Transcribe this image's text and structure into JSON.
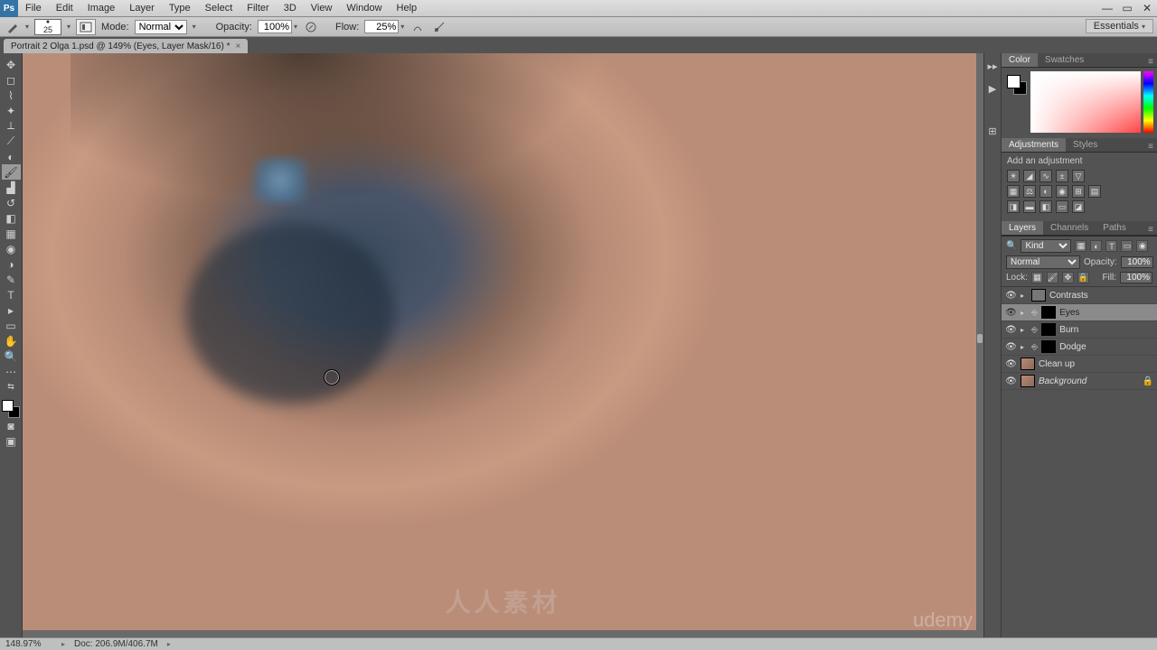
{
  "menubar": [
    "File",
    "Edit",
    "Image",
    "Layer",
    "Type",
    "Select",
    "Filter",
    "3D",
    "View",
    "Window",
    "Help"
  ],
  "options": {
    "brush_size": "25",
    "mode_label": "Mode:",
    "mode_value": "Normal",
    "opacity_label": "Opacity:",
    "opacity_value": "100%",
    "flow_label": "Flow:",
    "flow_value": "25%"
  },
  "workspace_label": "Essentials",
  "doc_tab": "Portrait 2 Olga 1.psd @ 149% (Eyes, Layer Mask/16) *",
  "panels": {
    "color_tab": "Color",
    "swatches_tab": "Swatches",
    "adjustments_tab": "Adjustments",
    "styles_tab": "Styles",
    "add_adjust": "Add an adjustment",
    "layers_tab": "Layers",
    "channels_tab": "Channels",
    "paths_tab": "Paths",
    "kind_label": "Kind",
    "blend_mode": "Normal",
    "opacity_lbl": "Opacity:",
    "opacity_val": "100%",
    "lock_lbl": "Lock:",
    "fill_lbl": "Fill:",
    "fill_val": "100%"
  },
  "layers": [
    {
      "name": "Contrasts",
      "group": true
    },
    {
      "name": "Eyes",
      "mask": true,
      "sel": true
    },
    {
      "name": "Burn",
      "mask": true
    },
    {
      "name": "Dodge",
      "mask": true
    },
    {
      "name": "Clean up",
      "thumb": "img"
    },
    {
      "name": "Background",
      "thumb": "img",
      "locked": true,
      "italic": true
    }
  ],
  "status": {
    "zoom": "148.97%",
    "doc": "Doc: 206.9M/406.7M"
  },
  "watermark": "人人素材",
  "udemy": "udemy"
}
